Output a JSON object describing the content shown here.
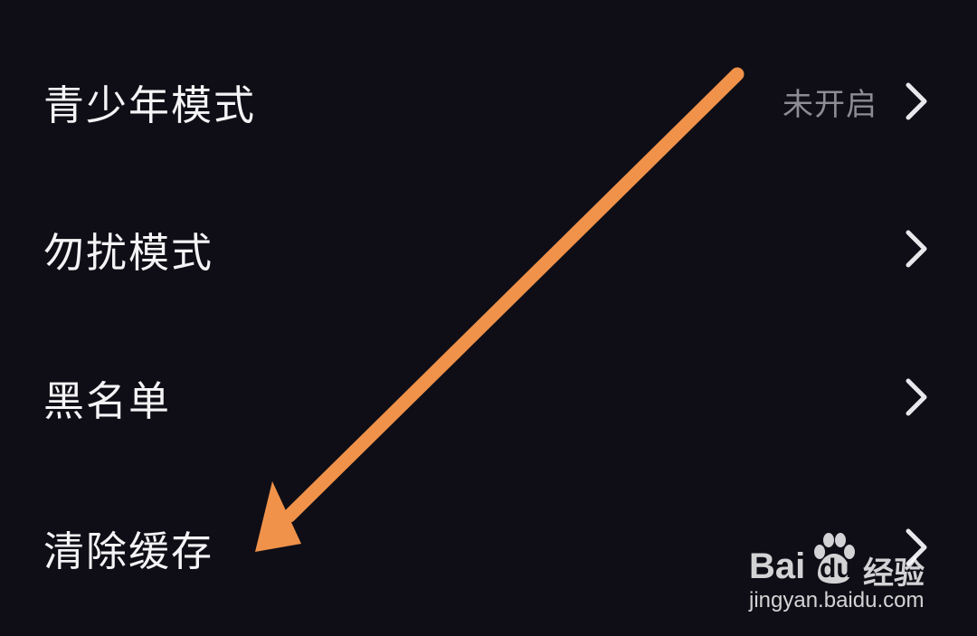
{
  "settings": {
    "items": [
      {
        "label": "青少年模式",
        "value": "未开启"
      },
      {
        "label": "勿扰模式",
        "value": ""
      },
      {
        "label": "黑名单",
        "value": ""
      },
      {
        "label": "清除缓存",
        "value": ""
      }
    ]
  },
  "annotation": {
    "arrow_color": "#f0924a",
    "points_to": "清除缓存"
  },
  "watermark": {
    "logo_text_left": "Bai",
    "logo_text_paw": "du",
    "logo_text_right": "经验",
    "url": "jingyan.baidu.com"
  },
  "icons": {
    "row_chevron": "chevron-right-icon",
    "annotation": "arrow-icon",
    "watermark": "baidu-paw-icon"
  },
  "colors": {
    "background": "#0f0e16",
    "text": "#f4f4f6",
    "secondary_text": "#8d8c95",
    "chevron": "#e8e8ec"
  }
}
